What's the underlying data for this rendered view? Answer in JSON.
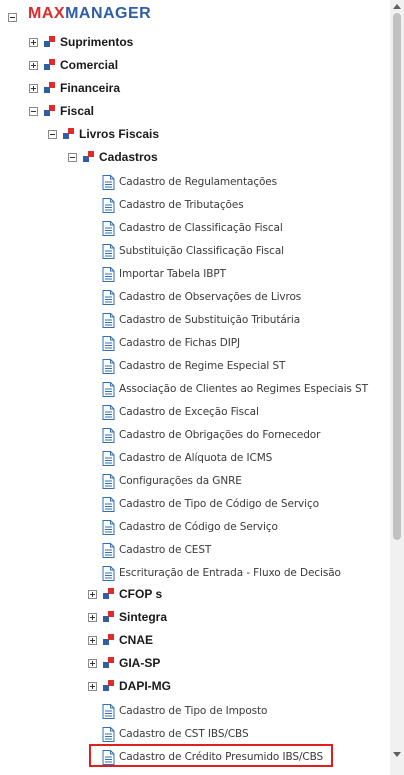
{
  "brand": {
    "part1": "MAX",
    "part2": "MANAGER"
  },
  "tree": {
    "root_toggle": "minus",
    "suprimentos": "Suprimentos",
    "comercial": "Comercial",
    "financeira": "Financeira",
    "fiscal": "Fiscal",
    "livros_fiscais": "Livros Fiscais",
    "cadastros": "Cadastros",
    "docs": [
      "Cadastro de Regulamentações",
      "Cadastro de Tributações",
      "Cadastro de Classificação Fiscal",
      "Substituição Classificação Fiscal",
      "Importar Tabela IBPT",
      "Cadastro de Observações de Livros",
      "Cadastro de Substituição Tributária",
      "Cadastro de Fichas DIPJ",
      "Cadastro de Regime Especial ST",
      "Associação de Clientes ao Regimes Especiais ST",
      "Cadastro de Exceção Fiscal",
      "Cadastro de Obrigações do Fornecedor",
      "Cadastro de Alíquota de ICMS",
      "Configurações da GNRE",
      "Cadastro de Tipo de Código de Serviço",
      "Cadastro de Código de Serviço",
      "Cadastro de CEST",
      "Escrituração de Entrada - Fluxo de Decisão"
    ],
    "cfops": "CFOP s",
    "sintegra": "Sintegra",
    "cnae": "CNAE",
    "gia_sp": "GIA-SP",
    "dapi_mg": "DAPI-MG",
    "docs2": [
      "Cadastro de Tipo de Imposto",
      "Cadastro de CST IBS/CBS",
      "Cadastro de Crédito Presumido IBS/CBS"
    ]
  },
  "colors": {
    "brand_red": "#e02b2b",
    "brand_blue": "#2e5fa3",
    "highlight": "#e02020"
  }
}
